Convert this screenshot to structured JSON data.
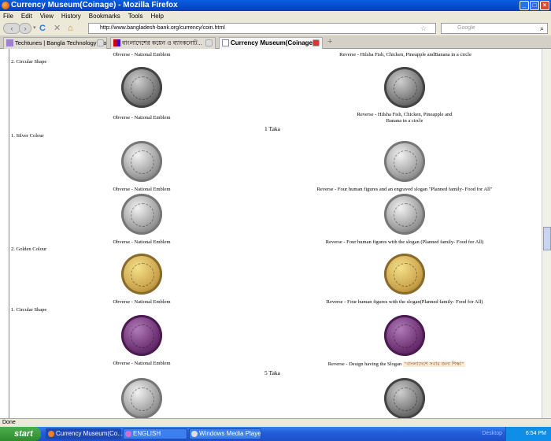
{
  "window": {
    "title": "Currency Museum(Coinage) - Mozilla Firefox"
  },
  "menu": [
    "File",
    "Edit",
    "View",
    "History",
    "Bookmarks",
    "Tools",
    "Help"
  ],
  "nav": {
    "url": "http://www.bangladesh-bank.org/currency/coin.html",
    "search_placeholder": "Google"
  },
  "tabs": [
    {
      "label": "Techtunes | Bangla Technology Bloggin..."
    },
    {
      "label": "বাংলাদেশের কয়েন ও ব্যাংকনোট..."
    },
    {
      "label": "Currency Museum(Coinage)"
    }
  ],
  "content": {
    "top_obverse": "Obverse - National Emblem",
    "top_reverse": "Reverse - Hilsha Fish, Chicken, Pineapple andBanana in a circle",
    "circular_shape_2": "2. Circular Shape",
    "obverse_1": "Obverse - National Emblem",
    "reverse_1a": "Reverse - Hilsha Fish, Chicken, Pineapple and",
    "reverse_1b": "Banana in a circle",
    "one_taka": "1 Taka",
    "silver_colour": "1. Silver Colour",
    "obverse_2": "Obverse - National Emblem",
    "reverse_2": "Reverse - Four human figures and an engraved slogan \"Planned family- Food for All\"",
    "obverse_3": "Obverse - National Emblem",
    "reverse_3": "Reverse - Four human figures with the slogan (Planned family- Food for All)",
    "golden_colour": "2. Golden Colour",
    "obverse_4": "Obverse - National Emblem",
    "reverse_4": "Reverse - Four human figures with the slogan(Planned family- Food for All)",
    "circular_shape_1": "1. Circular Shape",
    "obverse_5": "Obverse - National Emblem",
    "reverse_5": "Reverse - Design having the Slogan",
    "reverse_5_slogan": "\"বাংলাদেশে সবার জন্য শিক্ষা\"",
    "five_taka": "5 Taka"
  },
  "status": "Done",
  "taskbar": {
    "start": "start",
    "tasks": [
      "Currency Museum(Co...",
      "ENGLISH",
      "Windows Media Player"
    ],
    "desktop": "Desktop",
    "time": "6:54 PM"
  }
}
